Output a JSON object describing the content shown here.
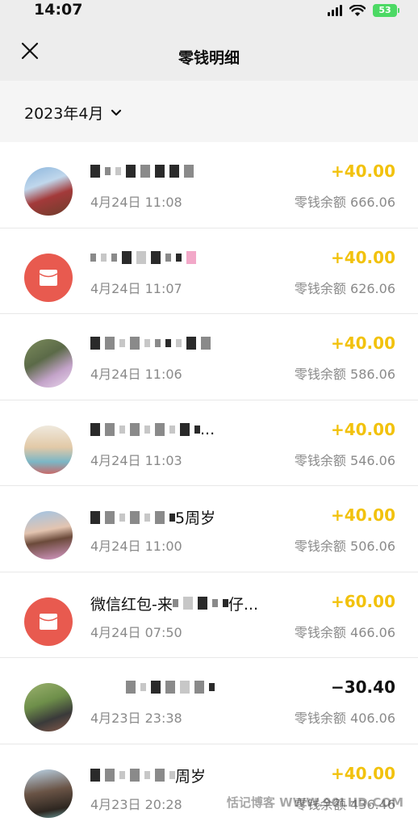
{
  "status_bar": {
    "time": "14:07",
    "battery": "53"
  },
  "header": {
    "title": "零钱明细"
  },
  "filter": {
    "month": "2023年4月"
  },
  "transactions": [
    {
      "title_suffix": "",
      "time": "4月24日 11:08",
      "amount": "+40.00",
      "balance": "零钱余额 666.06"
    },
    {
      "title_suffix": "",
      "time": "4月24日 11:07",
      "amount": "+40.00",
      "balance": "零钱余额 626.06"
    },
    {
      "title_suffix": "",
      "time": "4月24日 11:06",
      "amount": "+40.00",
      "balance": "零钱余额 586.06"
    },
    {
      "title_suffix": "...",
      "time": "4月24日 11:03",
      "amount": "+40.00",
      "balance": "零钱余额 546.06"
    },
    {
      "title_suffix": "5周岁",
      "time": "4月24日 11:00",
      "amount": "+40.00",
      "balance": "零钱余额 506.06"
    },
    {
      "title_prefix": "微信红包-来",
      "title_suffix": "仔...",
      "time": "4月24日 07:50",
      "amount": "+60.00",
      "balance": "零钱余额 466.06"
    },
    {
      "title_suffix": "",
      "time": "4月23日 23:38",
      "amount": "−30.40",
      "balance": "零钱余额 406.06"
    },
    {
      "title_suffix": "周岁",
      "time": "4月23日 20:28",
      "amount": "+40.00",
      "balance": "零钱余额 436.46"
    }
  ],
  "watermark": "恬记博客 WWW.90LHD.COM",
  "colors": {
    "income": "#f2c20d",
    "expense": "#111111",
    "red_packet": "#e85a4f"
  }
}
